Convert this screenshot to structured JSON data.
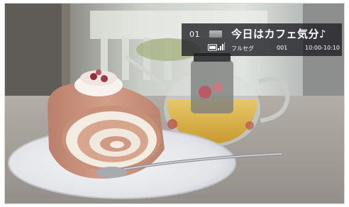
{
  "osd": {
    "channel_number": "01",
    "program_title": "今日はカフェ気分♪",
    "broadcast_type": "フルセグ",
    "service_number": "001",
    "time_range": "10:00-10:10",
    "icons": [
      "channel-logo-icon",
      "signal-strength-icon"
    ]
  },
  "colors": {
    "osd_background": "#1c1c22",
    "osd_text": "#ffffff"
  }
}
